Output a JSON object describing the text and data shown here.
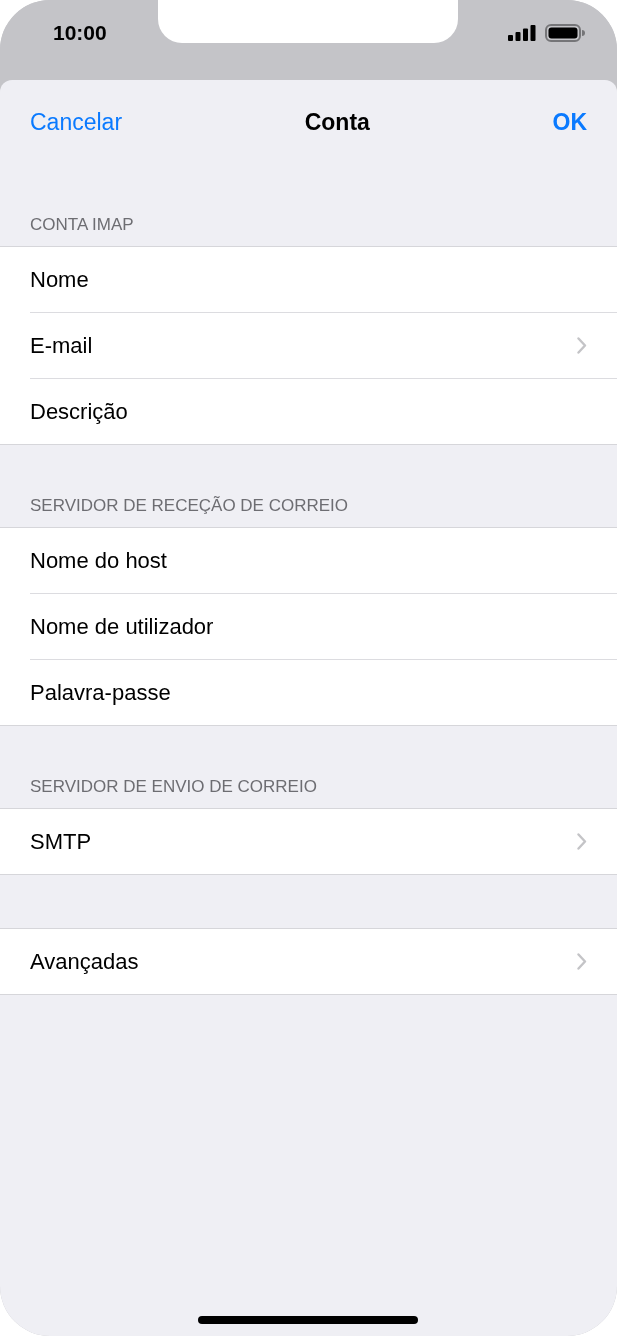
{
  "status_bar": {
    "time": "10:00"
  },
  "nav": {
    "cancel": "Cancelar",
    "title": "Conta",
    "done": "OK"
  },
  "sections": [
    {
      "header": "CONTA IMAP",
      "rows": [
        {
          "label": "Nome",
          "chevron": false
        },
        {
          "label": "E-mail",
          "chevron": true
        },
        {
          "label": "Descrição",
          "chevron": false
        }
      ]
    },
    {
      "header": "SERVIDOR DE RECEÇÃO DE CORREIO",
      "rows": [
        {
          "label": "Nome do host",
          "chevron": false
        },
        {
          "label": "Nome de utilizador",
          "chevron": false
        },
        {
          "label": "Palavra-passe",
          "chevron": false
        }
      ]
    },
    {
      "header": "SERVIDOR DE ENVIO DE CORREIO",
      "rows": [
        {
          "label": "SMTP",
          "chevron": true
        }
      ]
    },
    {
      "rows": [
        {
          "label": "Avançadas",
          "chevron": true
        }
      ]
    }
  ]
}
